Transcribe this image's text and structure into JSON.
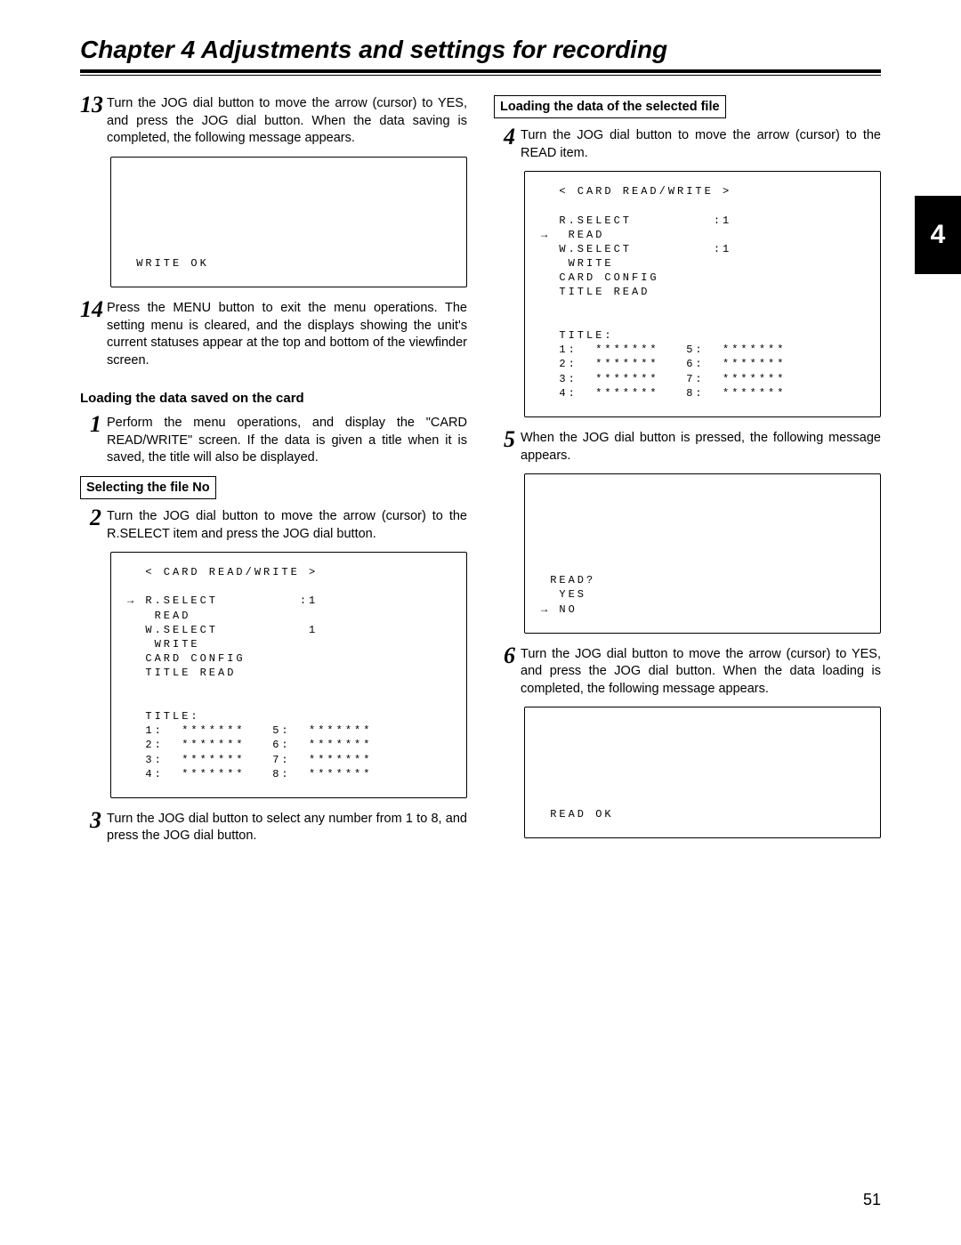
{
  "chapterTitle": "Chapter 4  Adjustments and settings for recording",
  "sideTab": "4",
  "pageNumber": "51",
  "left": {
    "step13": {
      "num": "13",
      "body": "Turn the JOG dial button to move the arrow (cursor) to YES, and press the JOG dial button.\nWhen the data saving is completed, the following message appears."
    },
    "screen_write_ok": "\n\n\n\n\n\n WRITE OK",
    "step14": {
      "num": "14",
      "body": "Press the MENU button to exit the menu operations.\nThe setting menu is cleared, and the displays showing the unit's current statuses appear at the top and bottom of the viewfinder screen."
    },
    "section_saved_head": "Loading the data saved on the card",
    "step1": {
      "num": "1",
      "body": "Perform the menu operations, and display the \"CARD READ/WRITE\" screen.\nIf the data is given a title when it is saved, the title will also be displayed."
    },
    "sel_label": "Selecting the file No",
    "step2": {
      "num": "2",
      "body": "Turn the JOG dial button to move the arrow (cursor) to the R.SELECT item and press the JOG dial button."
    },
    "screen_rselect": "  < CARD READ/WRITE >\n\n→ R.SELECT         :1\n   READ\n  W.SELECT          1\n   WRITE\n  CARD CONFIG\n  TITLE READ\n\n\n  TITLE:\n  1:  *******   5:  *******\n  2:  *******   6:  *******\n  3:  *******   7:  *******\n  4:  *******   8:  *******",
    "step3": {
      "num": "3",
      "body": "Turn the JOG dial button to select any number from 1 to 8, and press the JOG dial button."
    }
  },
  "right": {
    "sel_label": "Loading the data of the selected file",
    "step4": {
      "num": "4",
      "body": "Turn the JOG dial button to move the arrow (cursor) to the READ item."
    },
    "screen_read_item": "  < CARD READ/WRITE >\n\n  R.SELECT         :1\n→  READ\n  W.SELECT         :1\n   WRITE\n  CARD CONFIG\n  TITLE READ\n\n\n  TITLE:\n  1:  *******   5:  *******\n  2:  *******   6:  *******\n  3:  *******   7:  *******\n  4:  *******   8:  *******",
    "step5": {
      "num": "5",
      "body": "When the JOG dial button is pressed, the following message appears."
    },
    "screen_read_confirm": "\n\n\n\n\n\n READ?\n  YES\n→ NO",
    "step6": {
      "num": "6",
      "body": "Turn the JOG dial button to move the arrow (cursor) to YES, and press the JOG dial button.\nWhen the data loading is completed, the following message appears."
    },
    "screen_read_ok": "\n\n\n\n\n\n READ OK"
  }
}
